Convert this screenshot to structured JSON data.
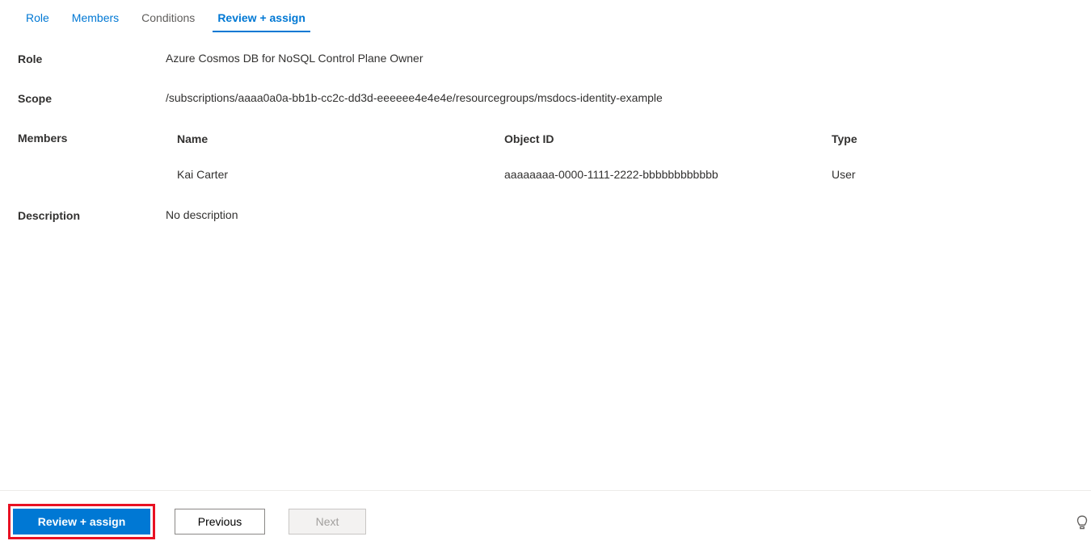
{
  "tabs": {
    "role": "Role",
    "members": "Members",
    "conditions": "Conditions",
    "review": "Review + assign"
  },
  "labels": {
    "role": "Role",
    "scope": "Scope",
    "members": "Members",
    "description": "Description"
  },
  "values": {
    "role": "Azure Cosmos DB for NoSQL Control Plane Owner",
    "scope": "/subscriptions/aaaa0a0a-bb1b-cc2c-dd3d-eeeeee4e4e4e/resourcegroups/msdocs-identity-example",
    "description": "No description"
  },
  "members_table": {
    "headers": {
      "name": "Name",
      "object_id": "Object ID",
      "type": "Type"
    },
    "rows": [
      {
        "name": "Kai Carter",
        "object_id": "aaaaaaaa-0000-1111-2222-bbbbbbbbbbbb",
        "type": "User"
      }
    ]
  },
  "footer": {
    "review_assign": "Review + assign",
    "previous": "Previous",
    "next": "Next"
  }
}
